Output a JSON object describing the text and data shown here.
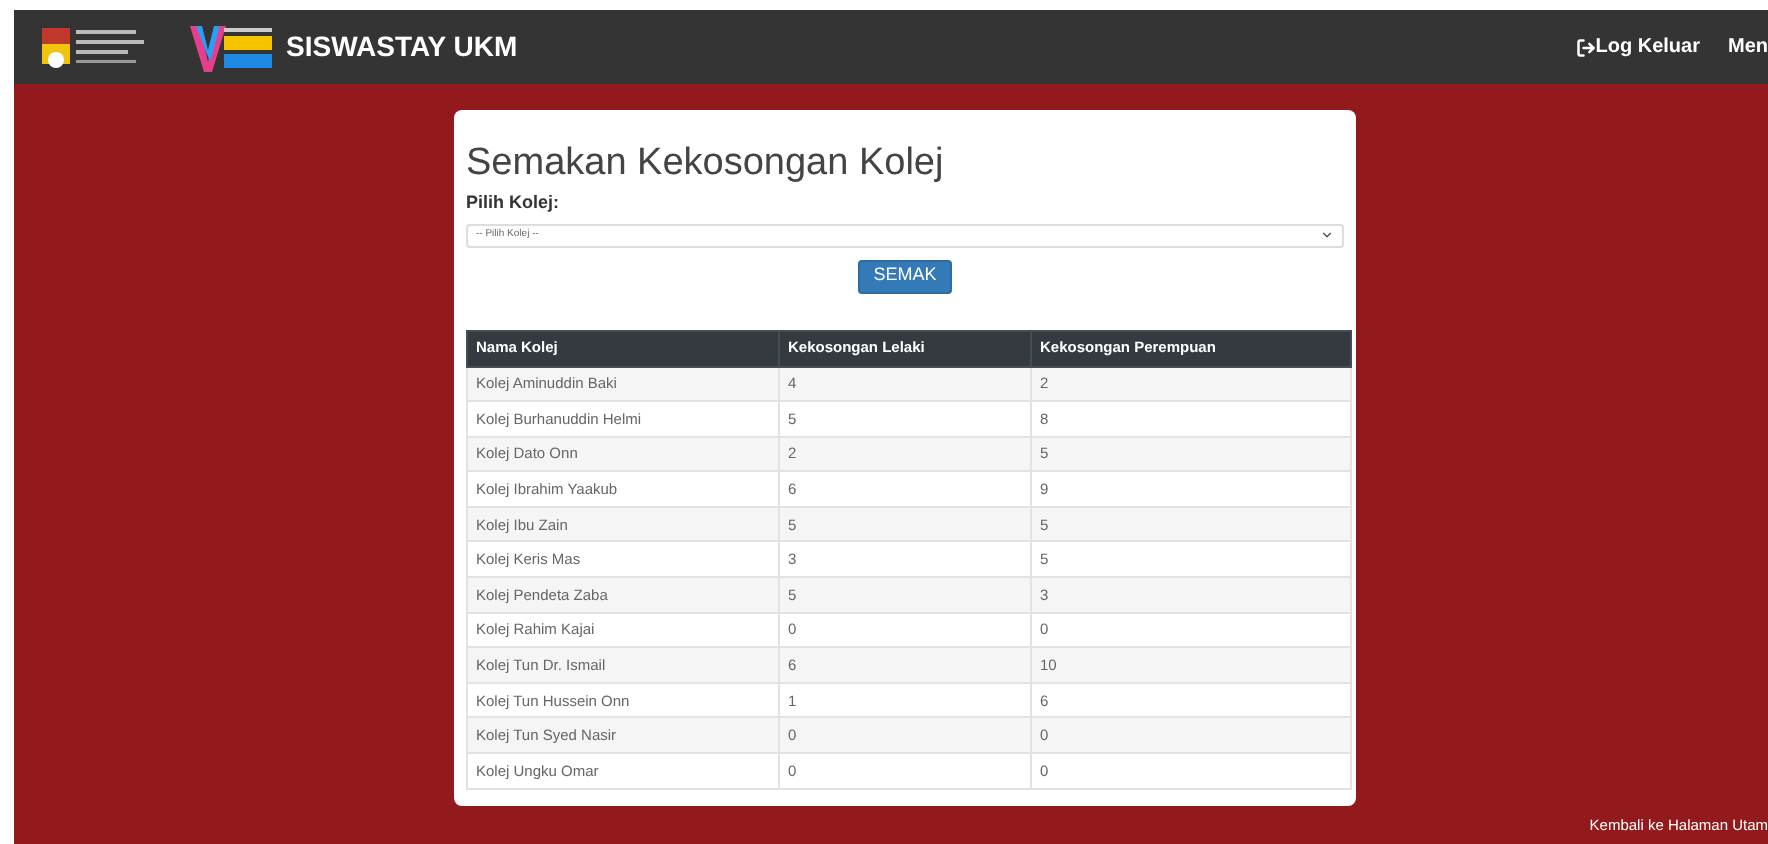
{
  "navbar": {
    "brand": "SISWASTAY UKM",
    "links": [
      {
        "kind": "logout",
        "label": "Log Keluar"
      },
      {
        "kind": "plain",
        "label": "Men"
      }
    ]
  },
  "card": {
    "title": "Semakan Kekosongan Kolej",
    "select_label": "Pilih Kolej:",
    "select": {
      "value": "-- Pilih Kolej --"
    },
    "button": "SEMAK"
  },
  "table": {
    "columns": [
      "Nama Kolej",
      "Kekosongan Lelaki",
      "Kekosongan Perempuan"
    ],
    "rows": [
      [
        "Kolej Aminuddin Baki",
        "4",
        "2"
      ],
      [
        "Kolej Burhanuddin Helmi",
        "5",
        "8"
      ],
      [
        "Kolej Dato Onn",
        "2",
        "5"
      ],
      [
        "Kolej Ibrahim Yaakub",
        "6",
        "9"
      ],
      [
        "Kolej Ibu Zain",
        "5",
        "5"
      ],
      [
        "Kolej Keris Mas",
        "3",
        "5"
      ],
      [
        "Kolej Pendeta Zaba",
        "5",
        "3"
      ],
      [
        "Kolej Rahim Kajai",
        "0",
        "0"
      ],
      [
        "Kolej Tun Dr. Ismail",
        "6",
        "10"
      ],
      [
        "Kolej Tun Hussein Onn",
        "1",
        "6"
      ],
      [
        "Kolej Tun Syed Nasir",
        "0",
        "0"
      ],
      [
        "Kolej Ungku Omar",
        "0",
        "0"
      ]
    ]
  },
  "footer_link": "Kembali ke Halaman Utam"
}
